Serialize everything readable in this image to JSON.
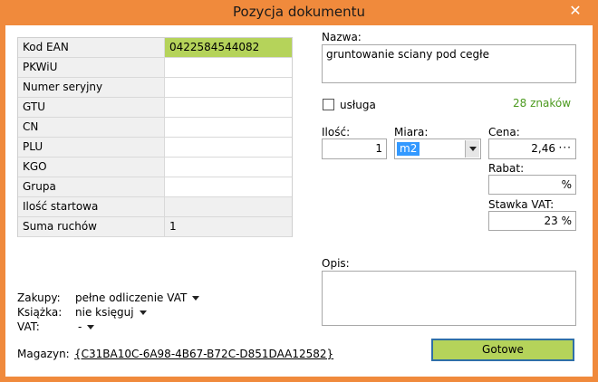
{
  "window": {
    "title": "Pozycja dokumentu",
    "close_glyph": "✕"
  },
  "props": [
    {
      "label": "Kod EAN",
      "value": "0422584544082",
      "style": "hl"
    },
    {
      "label": "PKWiU",
      "value": "",
      "style": ""
    },
    {
      "label": "Numer seryjny",
      "value": "",
      "style": ""
    },
    {
      "label": "GTU",
      "value": "",
      "style": ""
    },
    {
      "label": "CN",
      "value": "",
      "style": ""
    },
    {
      "label": "PLU",
      "value": "",
      "style": ""
    },
    {
      "label": "KGO",
      "value": "",
      "style": ""
    },
    {
      "label": "Grupa",
      "value": "",
      "style": ""
    },
    {
      "label": "Ilość startowa",
      "value": "",
      "style": "gray"
    },
    {
      "label": "Suma ruchów",
      "value": "1",
      "style": "gray"
    }
  ],
  "settings": {
    "zakupy_label": "Zakupy:",
    "zakupy_value": "pełne odliczenie VAT",
    "ksiazka_label": "Książka:",
    "ksiazka_value": "nie księguj",
    "vat_label": "VAT:",
    "vat_value": "-"
  },
  "magazyn": {
    "label": "Magazyn:",
    "value": "{C31BA10C-6A98-4B67-B72C-D851DAA12582}"
  },
  "nazwa": {
    "label": "Nazwa:",
    "value": "gruntowanie sciany pod cegłe",
    "char_count": "28 znaków"
  },
  "usluga_label": "usługa",
  "ilosc": {
    "label": "Ilość:",
    "value": "1"
  },
  "miara": {
    "label": "Miara:",
    "value": "m2"
  },
  "cena": {
    "label": "Cena:",
    "value": "2,46",
    "button": "···"
  },
  "rabat": {
    "label": "Rabat:",
    "value": "%"
  },
  "stawka": {
    "label": "Stawka VAT:",
    "value": "23 %"
  },
  "opis": {
    "label": "Opis:",
    "value": ""
  },
  "ok_label": "Gotowe",
  "colors": {
    "titlebar": "#f08a3c",
    "highlight": "#b5d35a",
    "counter": "#4c9a1f"
  }
}
